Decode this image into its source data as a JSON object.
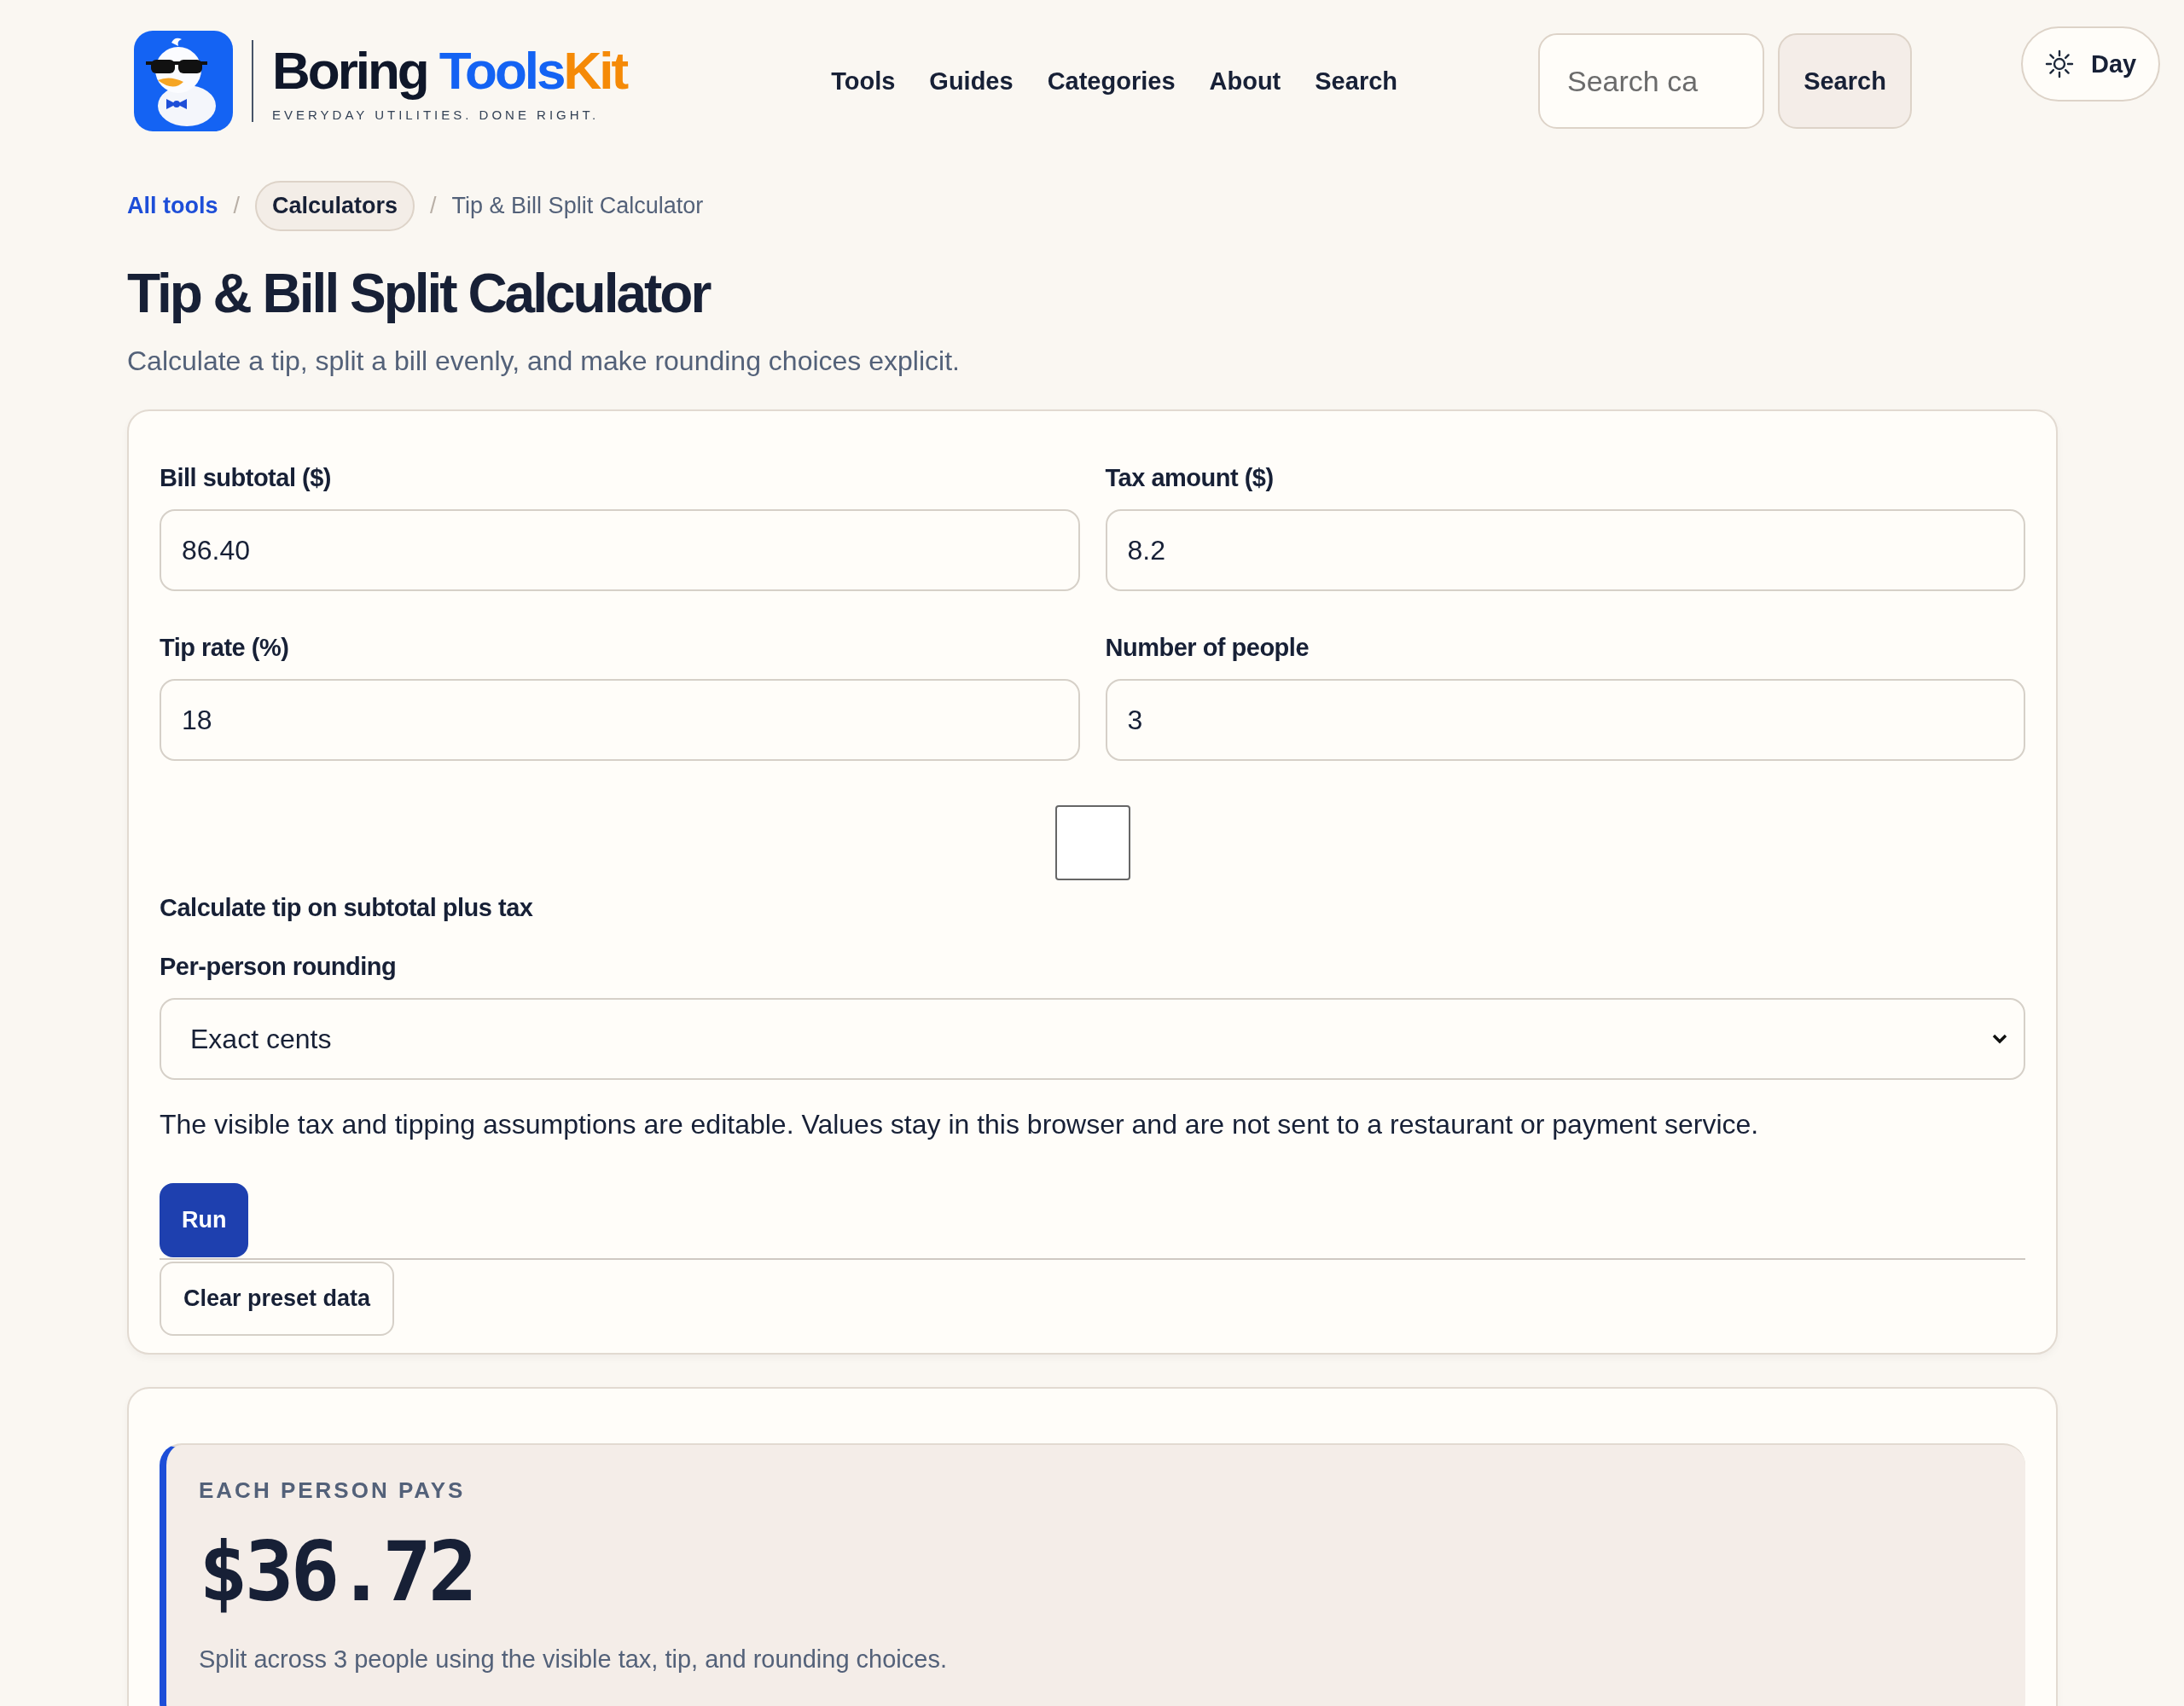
{
  "header": {
    "brand": [
      {
        "text": "Boring",
        "color": "#0f172a"
      },
      {
        "text": "Tools",
        "color": "#1463f3"
      },
      {
        "text": "Kit",
        "color": "#f58a07"
      }
    ],
    "tagline": "EVERYDAY UTILITIES. DONE RIGHT.",
    "nav": [
      "Tools",
      "Guides",
      "Categories",
      "About",
      "Search"
    ],
    "search": {
      "placeholder": "Search ca",
      "button": "Search"
    },
    "theme_toggle": "Day"
  },
  "breadcrumb": [
    {
      "text": "All tools",
      "kind": "link"
    },
    {
      "text": "/",
      "kind": "separator"
    },
    {
      "text": "Calculators",
      "kind": "chip"
    },
    {
      "text": "/",
      "kind": "separator"
    },
    {
      "text": "Tip & Bill Split Calculator",
      "kind": "current"
    }
  ],
  "title": "Tip & Bill Split Calculator",
  "subtitle": "Calculate a tip, split a bill evenly, and make rounding choices explicit.",
  "form": {
    "fields": [
      {
        "label": "Bill subtotal ($)",
        "value": "86.40"
      },
      {
        "label": "Tax amount ($)",
        "value": "8.2"
      },
      {
        "label": "Tip rate (%)",
        "value": "18"
      },
      {
        "label": "Number of people",
        "value": "3"
      }
    ],
    "checkbox": {
      "label": "Calculate tip on subtotal plus tax",
      "checked": false
    },
    "select": {
      "label": "Per-person rounding",
      "value": "Exact cents"
    },
    "note": "The visible tax and tipping assumptions are editable. Values stay in this browser and are not sent to a restaurant or payment service.",
    "buttons": [
      {
        "label": "Run",
        "kind": "primary"
      },
      {
        "label": "Clear preset data",
        "kind": "secondary"
      }
    ]
  },
  "result": {
    "eyebrow": "EACH PERSON PAYS",
    "amount": "$36.72",
    "description": "Split across 3 people using the visible tax, tip, and rounding choices."
  }
}
